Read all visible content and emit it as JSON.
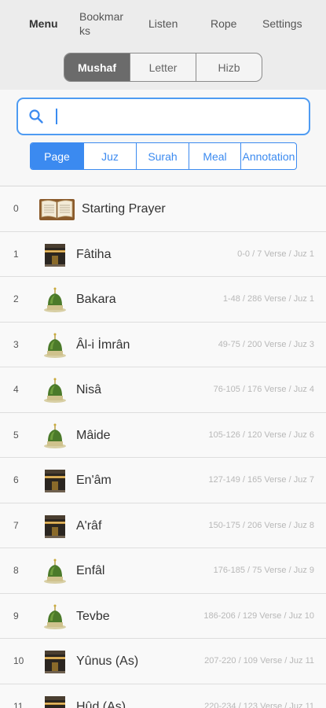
{
  "nav": {
    "menu": "Menu",
    "bookmarks": "Bookmarks",
    "listen": "Listen",
    "rope": "Rope",
    "settings": "Settings"
  },
  "mode_tabs": [
    "Mushaf",
    "Letter",
    "Hizb"
  ],
  "search": {
    "value": "",
    "placeholder": ""
  },
  "filter_tabs": [
    "Page",
    "Juz",
    "Surah",
    "Meal",
    "Annotation"
  ],
  "rows": [
    {
      "index": "0",
      "name": "Starting Prayer",
      "info": "",
      "icon": "open-book-icon"
    },
    {
      "index": "1",
      "name": "Fâtiha",
      "info": "0-0 / 7 Verse / Juz 1",
      "icon": "kaaba-icon"
    },
    {
      "index": "2",
      "name": "Bakara",
      "info": "1-48 / 286 Verse / Juz 1",
      "icon": "green-dome-icon"
    },
    {
      "index": "3",
      "name": "Âl-i İmrân",
      "info": "49-75 / 200 Verse / Juz 3",
      "icon": "green-dome-icon"
    },
    {
      "index": "4",
      "name": "Nisâ",
      "info": "76-105 / 176 Verse / Juz 4",
      "icon": "green-dome-icon"
    },
    {
      "index": "5",
      "name": "Mâide",
      "info": "105-126 / 120 Verse / Juz 6",
      "icon": "green-dome-icon"
    },
    {
      "index": "6",
      "name": "En'âm",
      "info": "127-149 / 165 Verse / Juz 7",
      "icon": "kaaba-icon"
    },
    {
      "index": "7",
      "name": "A'râf",
      "info": "150-175 / 206 Verse / Juz 8",
      "icon": "kaaba-icon"
    },
    {
      "index": "8",
      "name": "Enfâl",
      "info": "176-185 / 75 Verse / Juz 9",
      "icon": "green-dome-icon"
    },
    {
      "index": "9",
      "name": "Tevbe",
      "info": "186-206 / 129 Verse / Juz 10",
      "icon": "green-dome-icon"
    },
    {
      "index": "10",
      "name": "Yûnus (As)",
      "info": "207-220 / 109 Verse / Juz 11",
      "icon": "kaaba-icon"
    },
    {
      "index": "11",
      "name": "Hûd (As)",
      "info": "220-234 / 123 Verse / Juz 11",
      "icon": "kaaba-icon"
    }
  ],
  "colors": {
    "accent": "#3b8af0",
    "active_segment": "#6b6b6b"
  }
}
